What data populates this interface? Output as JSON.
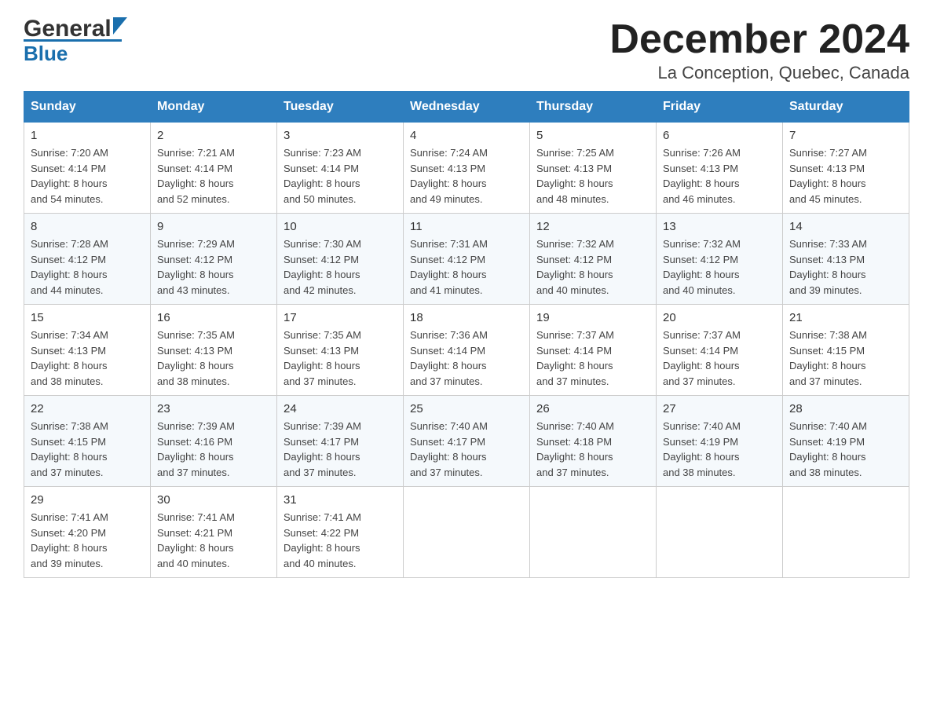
{
  "header": {
    "logo_general": "General",
    "logo_blue": "Blue",
    "title": "December 2024",
    "subtitle": "La Conception, Quebec, Canada"
  },
  "days_of_week": [
    "Sunday",
    "Monday",
    "Tuesday",
    "Wednesday",
    "Thursday",
    "Friday",
    "Saturday"
  ],
  "weeks": [
    [
      {
        "day": "1",
        "sunrise": "7:20 AM",
        "sunset": "4:14 PM",
        "daylight": "8 hours and 54 minutes."
      },
      {
        "day": "2",
        "sunrise": "7:21 AM",
        "sunset": "4:14 PM",
        "daylight": "8 hours and 52 minutes."
      },
      {
        "day": "3",
        "sunrise": "7:23 AM",
        "sunset": "4:14 PM",
        "daylight": "8 hours and 50 minutes."
      },
      {
        "day": "4",
        "sunrise": "7:24 AM",
        "sunset": "4:13 PM",
        "daylight": "8 hours and 49 minutes."
      },
      {
        "day": "5",
        "sunrise": "7:25 AM",
        "sunset": "4:13 PM",
        "daylight": "8 hours and 48 minutes."
      },
      {
        "day": "6",
        "sunrise": "7:26 AM",
        "sunset": "4:13 PM",
        "daylight": "8 hours and 46 minutes."
      },
      {
        "day": "7",
        "sunrise": "7:27 AM",
        "sunset": "4:13 PM",
        "daylight": "8 hours and 45 minutes."
      }
    ],
    [
      {
        "day": "8",
        "sunrise": "7:28 AM",
        "sunset": "4:12 PM",
        "daylight": "8 hours and 44 minutes."
      },
      {
        "day": "9",
        "sunrise": "7:29 AM",
        "sunset": "4:12 PM",
        "daylight": "8 hours and 43 minutes."
      },
      {
        "day": "10",
        "sunrise": "7:30 AM",
        "sunset": "4:12 PM",
        "daylight": "8 hours and 42 minutes."
      },
      {
        "day": "11",
        "sunrise": "7:31 AM",
        "sunset": "4:12 PM",
        "daylight": "8 hours and 41 minutes."
      },
      {
        "day": "12",
        "sunrise": "7:32 AM",
        "sunset": "4:12 PM",
        "daylight": "8 hours and 40 minutes."
      },
      {
        "day": "13",
        "sunrise": "7:32 AM",
        "sunset": "4:12 PM",
        "daylight": "8 hours and 40 minutes."
      },
      {
        "day": "14",
        "sunrise": "7:33 AM",
        "sunset": "4:13 PM",
        "daylight": "8 hours and 39 minutes."
      }
    ],
    [
      {
        "day": "15",
        "sunrise": "7:34 AM",
        "sunset": "4:13 PM",
        "daylight": "8 hours and 38 minutes."
      },
      {
        "day": "16",
        "sunrise": "7:35 AM",
        "sunset": "4:13 PM",
        "daylight": "8 hours and 38 minutes."
      },
      {
        "day": "17",
        "sunrise": "7:35 AM",
        "sunset": "4:13 PM",
        "daylight": "8 hours and 37 minutes."
      },
      {
        "day": "18",
        "sunrise": "7:36 AM",
        "sunset": "4:14 PM",
        "daylight": "8 hours and 37 minutes."
      },
      {
        "day": "19",
        "sunrise": "7:37 AM",
        "sunset": "4:14 PM",
        "daylight": "8 hours and 37 minutes."
      },
      {
        "day": "20",
        "sunrise": "7:37 AM",
        "sunset": "4:14 PM",
        "daylight": "8 hours and 37 minutes."
      },
      {
        "day": "21",
        "sunrise": "7:38 AM",
        "sunset": "4:15 PM",
        "daylight": "8 hours and 37 minutes."
      }
    ],
    [
      {
        "day": "22",
        "sunrise": "7:38 AM",
        "sunset": "4:15 PM",
        "daylight": "8 hours and 37 minutes."
      },
      {
        "day": "23",
        "sunrise": "7:39 AM",
        "sunset": "4:16 PM",
        "daylight": "8 hours and 37 minutes."
      },
      {
        "day": "24",
        "sunrise": "7:39 AM",
        "sunset": "4:17 PM",
        "daylight": "8 hours and 37 minutes."
      },
      {
        "day": "25",
        "sunrise": "7:40 AM",
        "sunset": "4:17 PM",
        "daylight": "8 hours and 37 minutes."
      },
      {
        "day": "26",
        "sunrise": "7:40 AM",
        "sunset": "4:18 PM",
        "daylight": "8 hours and 37 minutes."
      },
      {
        "day": "27",
        "sunrise": "7:40 AM",
        "sunset": "4:19 PM",
        "daylight": "8 hours and 38 minutes."
      },
      {
        "day": "28",
        "sunrise": "7:40 AM",
        "sunset": "4:19 PM",
        "daylight": "8 hours and 38 minutes."
      }
    ],
    [
      {
        "day": "29",
        "sunrise": "7:41 AM",
        "sunset": "4:20 PM",
        "daylight": "8 hours and 39 minutes."
      },
      {
        "day": "30",
        "sunrise": "7:41 AM",
        "sunset": "4:21 PM",
        "daylight": "8 hours and 40 minutes."
      },
      {
        "day": "31",
        "sunrise": "7:41 AM",
        "sunset": "4:22 PM",
        "daylight": "8 hours and 40 minutes."
      },
      null,
      null,
      null,
      null
    ]
  ],
  "labels": {
    "sunrise": "Sunrise:",
    "sunset": "Sunset:",
    "daylight": "Daylight:"
  }
}
